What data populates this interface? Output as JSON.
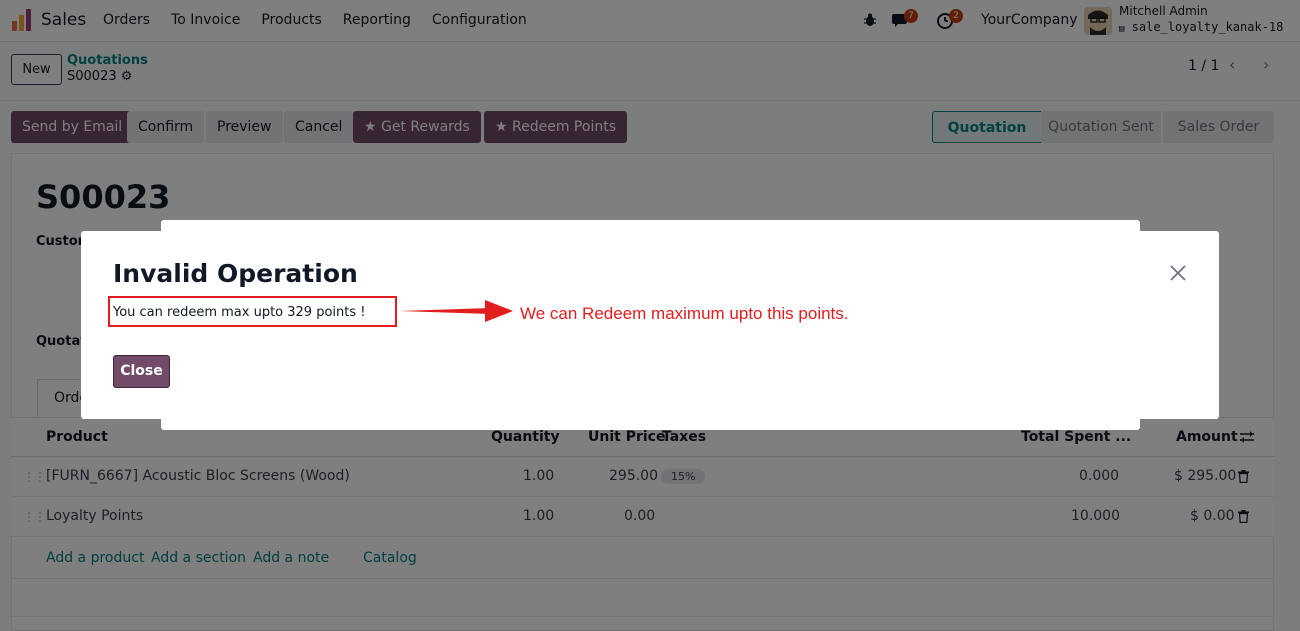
{
  "navbar": {
    "app_name": "Sales",
    "menu": [
      "Orders",
      "To Invoice",
      "Products",
      "Reporting",
      "Configuration"
    ],
    "messages_count": "7",
    "activities_count": "2",
    "company": "YourCompany",
    "user_name": "Mitchell Admin",
    "db_name": "sale_loyalty_kanak-18"
  },
  "control": {
    "new_label": "New",
    "breadcrumb_parent": "Quotations",
    "breadcrumb_current": "S00023",
    "pager": "1 / 1"
  },
  "actions": {
    "send_email": "Send by Email",
    "confirm": "Confirm",
    "preview": "Preview",
    "cancel": "Cancel",
    "get_rewards": "Get Rewards",
    "redeem_points": "Redeem Points"
  },
  "statusbar": [
    "Quotation",
    "Quotation Sent",
    "Sales Order"
  ],
  "form": {
    "order_name": "S00023",
    "customer_label": "Custom",
    "quotation_label": "Quotat",
    "tab_label": "Orde"
  },
  "table": {
    "headers": {
      "product": "Product",
      "quantity": "Quantity",
      "unit_price": "Unit Price",
      "taxes": "Taxes",
      "total_spent": "Total Spent ...",
      "amount": "Amount"
    },
    "rows": [
      {
        "product": "[FURN_6667] Acoustic Bloc Screens (Wood)",
        "quantity": "1.00",
        "unit_price": "295.00",
        "tax": "15%",
        "total_spent": "0.000",
        "amount": "$ 295.00"
      },
      {
        "product": "Loyalty Points",
        "quantity": "1.00",
        "unit_price": "0.00",
        "tax": "",
        "total_spent": "10.000",
        "amount": "$ 0.00"
      }
    ],
    "add_product": "Add a product",
    "add_section": "Add a section",
    "add_note": "Add a note",
    "catalog": "Catalog"
  },
  "dialog": {
    "title": "Invalid Operation",
    "message": "You can redeem max upto 329 points !",
    "annotation": "We can Redeem maximum upto this points.",
    "close_label": "Close"
  },
  "colors": {
    "brand": "#714b67",
    "accent": "#017e84",
    "annotation": "#e11d1d"
  }
}
